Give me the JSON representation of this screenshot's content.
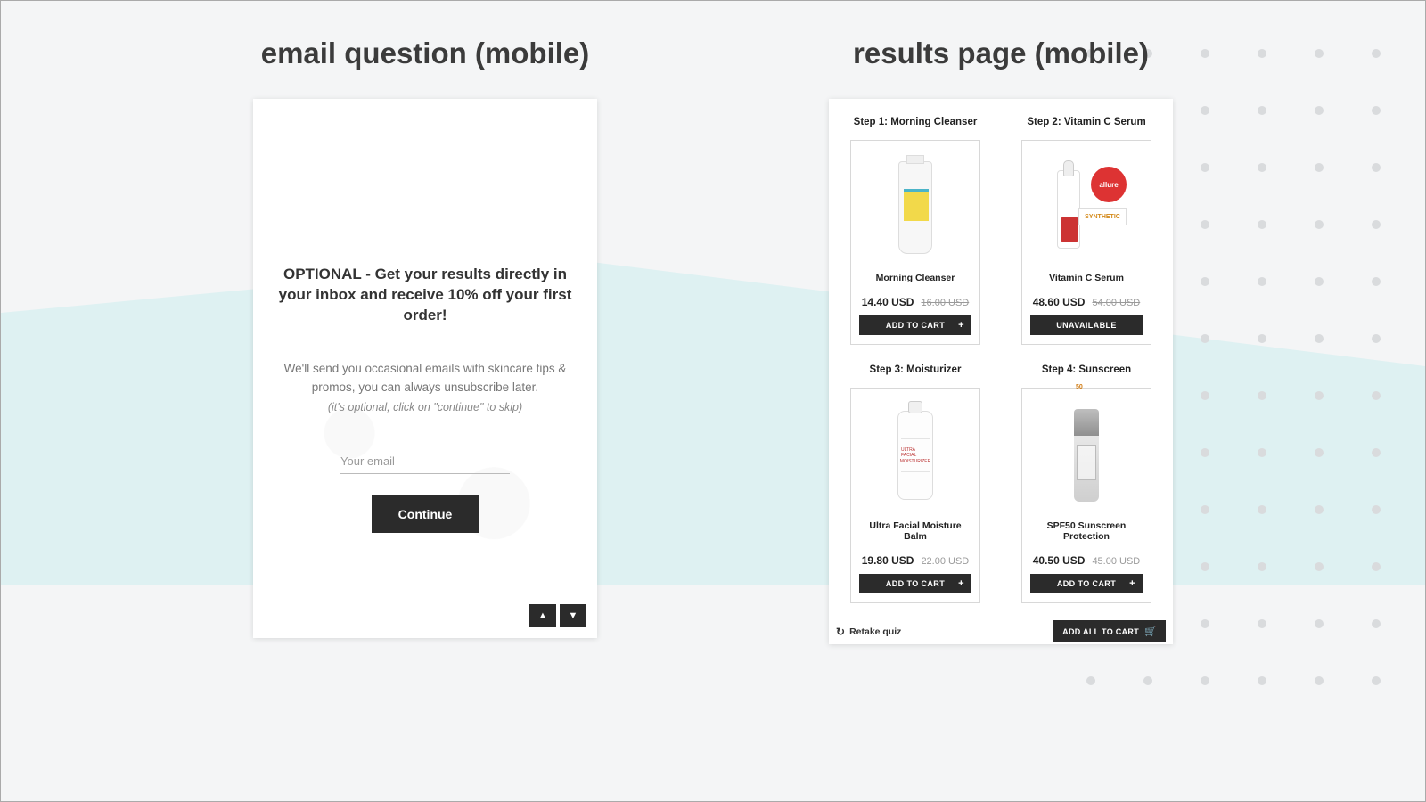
{
  "columns": {
    "left_title": "email question (mobile)",
    "right_title": "results page (mobile)"
  },
  "email": {
    "headline": "OPTIONAL - Get your results directly in your inbox and receive 10% off your first order!",
    "subtext": "We'll send you occasional emails with skincare tips & promos, you can always unsubscribe later.",
    "hint": "(it's optional, click on \"continue\" to skip)",
    "placeholder": "Your email",
    "continue_label": "Continue"
  },
  "results": {
    "steps": [
      {
        "step_label": "Step 1: Morning Cleanser",
        "name": "Morning Cleanser",
        "price": "14.40 USD",
        "old_price": "16.00 USD",
        "button": "ADD TO CART",
        "has_plus": true
      },
      {
        "step_label": "Step 2: Vitamin C Serum",
        "name": "Vitamin C Serum",
        "price": "48.60 USD",
        "old_price": "54.00 USD",
        "button": "UNAVAILABLE",
        "has_plus": false,
        "badge_text": "allure",
        "tag_text": "SYNTHETIC"
      },
      {
        "step_label": "Step 3: Moisturizer",
        "name": "Ultra Facial Moisture Balm",
        "price": "19.80 USD",
        "old_price": "22.00 USD",
        "button": "ADD TO CART",
        "has_plus": true,
        "bottle_line1": "ULTRA FACIAL",
        "bottle_line2": "MOISTURIZER"
      },
      {
        "step_label": "Step 4: Sunscreen",
        "name": "SPF50 Sunscreen Protection",
        "price": "40.50 USD",
        "old_price": "45.00 USD",
        "button": "ADD TO CART",
        "has_plus": true,
        "spf_num": "50"
      }
    ],
    "retake_label": "Retake quiz",
    "add_all_label": "ADD ALL TO CART"
  }
}
